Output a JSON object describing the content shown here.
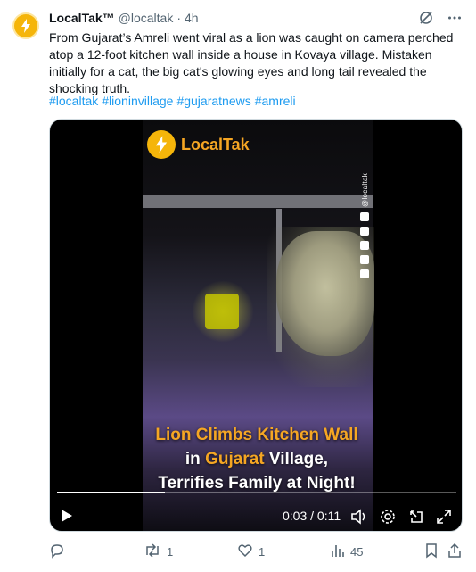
{
  "tweet": {
    "name": "LocalTak™",
    "handle": "@localtak",
    "dot": "·",
    "time": "4h",
    "text": "From Gujarat’s Amreli went viral as a lion was caught on camera perched atop a 12-foot kitchen wall inside a house in Kovaya village. Mistaken initially for a cat, the big cat's glowing eyes and long tail revealed the shocking truth.",
    "hashtags": [
      "#localtak",
      "#lioninvillage",
      "#gujaratnews",
      "#amreli"
    ]
  },
  "video": {
    "brand": "LocalTak",
    "side_handle": "@localtak",
    "caption": {
      "line1": "Lion Climbs Kitchen Wall",
      "line2_pre": "in ",
      "line2_hl": "Gujarat",
      "line2_post": " Village,",
      "line3": "Terrifies Family at Night!"
    },
    "time_display": "0:03 / 0:11",
    "progress": 0.27
  },
  "actions": {
    "reply_count": "",
    "repost_count": "1",
    "like_count": "1",
    "views_count": "45"
  },
  "colors": {
    "accent": "#1d9bf0",
    "brand": "#f5a623",
    "muted": "#536471"
  },
  "icons": {
    "top": [
      "grok-icon",
      "more-icon"
    ],
    "video": [
      "play-icon",
      "volume-icon",
      "settings-icon",
      "pip-icon",
      "fullscreen-icon"
    ],
    "actions": [
      "reply-icon",
      "repost-icon",
      "like-icon",
      "views-icon",
      "bookmark-icon",
      "share-icon"
    ]
  }
}
